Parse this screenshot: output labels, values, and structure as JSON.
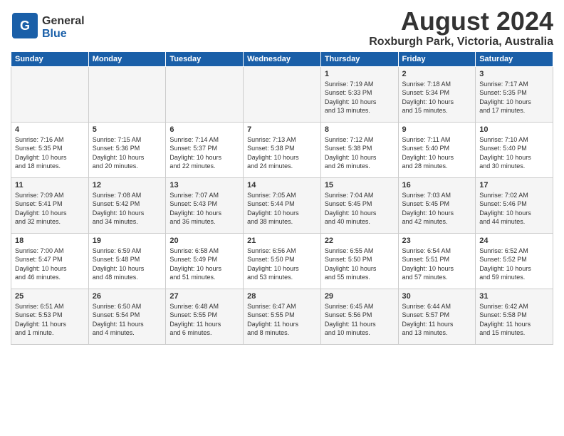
{
  "header": {
    "logo_general": "General",
    "logo_blue": "Blue",
    "month_title": "August 2024",
    "location": "Roxburgh Park, Victoria, Australia"
  },
  "days_of_week": [
    "Sunday",
    "Monday",
    "Tuesday",
    "Wednesday",
    "Thursday",
    "Friday",
    "Saturday"
  ],
  "weeks": [
    [
      {
        "day": "",
        "info": ""
      },
      {
        "day": "",
        "info": ""
      },
      {
        "day": "",
        "info": ""
      },
      {
        "day": "",
        "info": ""
      },
      {
        "day": "1",
        "info": "Sunrise: 7:19 AM\nSunset: 5:33 PM\nDaylight: 10 hours\nand 13 minutes."
      },
      {
        "day": "2",
        "info": "Sunrise: 7:18 AM\nSunset: 5:34 PM\nDaylight: 10 hours\nand 15 minutes."
      },
      {
        "day": "3",
        "info": "Sunrise: 7:17 AM\nSunset: 5:35 PM\nDaylight: 10 hours\nand 17 minutes."
      }
    ],
    [
      {
        "day": "4",
        "info": "Sunrise: 7:16 AM\nSunset: 5:35 PM\nDaylight: 10 hours\nand 18 minutes."
      },
      {
        "day": "5",
        "info": "Sunrise: 7:15 AM\nSunset: 5:36 PM\nDaylight: 10 hours\nand 20 minutes."
      },
      {
        "day": "6",
        "info": "Sunrise: 7:14 AM\nSunset: 5:37 PM\nDaylight: 10 hours\nand 22 minutes."
      },
      {
        "day": "7",
        "info": "Sunrise: 7:13 AM\nSunset: 5:38 PM\nDaylight: 10 hours\nand 24 minutes."
      },
      {
        "day": "8",
        "info": "Sunrise: 7:12 AM\nSunset: 5:38 PM\nDaylight: 10 hours\nand 26 minutes."
      },
      {
        "day": "9",
        "info": "Sunrise: 7:11 AM\nSunset: 5:40 PM\nDaylight: 10 hours\nand 28 minutes."
      },
      {
        "day": "10",
        "info": "Sunrise: 7:10 AM\nSunset: 5:40 PM\nDaylight: 10 hours\nand 30 minutes."
      }
    ],
    [
      {
        "day": "11",
        "info": "Sunrise: 7:09 AM\nSunset: 5:41 PM\nDaylight: 10 hours\nand 32 minutes."
      },
      {
        "day": "12",
        "info": "Sunrise: 7:08 AM\nSunset: 5:42 PM\nDaylight: 10 hours\nand 34 minutes."
      },
      {
        "day": "13",
        "info": "Sunrise: 7:07 AM\nSunset: 5:43 PM\nDaylight: 10 hours\nand 36 minutes."
      },
      {
        "day": "14",
        "info": "Sunrise: 7:05 AM\nSunset: 5:44 PM\nDaylight: 10 hours\nand 38 minutes."
      },
      {
        "day": "15",
        "info": "Sunrise: 7:04 AM\nSunset: 5:45 PM\nDaylight: 10 hours\nand 40 minutes."
      },
      {
        "day": "16",
        "info": "Sunrise: 7:03 AM\nSunset: 5:45 PM\nDaylight: 10 hours\nand 42 minutes."
      },
      {
        "day": "17",
        "info": "Sunrise: 7:02 AM\nSunset: 5:46 PM\nDaylight: 10 hours\nand 44 minutes."
      }
    ],
    [
      {
        "day": "18",
        "info": "Sunrise: 7:00 AM\nSunset: 5:47 PM\nDaylight: 10 hours\nand 46 minutes."
      },
      {
        "day": "19",
        "info": "Sunrise: 6:59 AM\nSunset: 5:48 PM\nDaylight: 10 hours\nand 48 minutes."
      },
      {
        "day": "20",
        "info": "Sunrise: 6:58 AM\nSunset: 5:49 PM\nDaylight: 10 hours\nand 51 minutes."
      },
      {
        "day": "21",
        "info": "Sunrise: 6:56 AM\nSunset: 5:50 PM\nDaylight: 10 hours\nand 53 minutes."
      },
      {
        "day": "22",
        "info": "Sunrise: 6:55 AM\nSunset: 5:50 PM\nDaylight: 10 hours\nand 55 minutes."
      },
      {
        "day": "23",
        "info": "Sunrise: 6:54 AM\nSunset: 5:51 PM\nDaylight: 10 hours\nand 57 minutes."
      },
      {
        "day": "24",
        "info": "Sunrise: 6:52 AM\nSunset: 5:52 PM\nDaylight: 10 hours\nand 59 minutes."
      }
    ],
    [
      {
        "day": "25",
        "info": "Sunrise: 6:51 AM\nSunset: 5:53 PM\nDaylight: 11 hours\nand 1 minute."
      },
      {
        "day": "26",
        "info": "Sunrise: 6:50 AM\nSunset: 5:54 PM\nDaylight: 11 hours\nand 4 minutes."
      },
      {
        "day": "27",
        "info": "Sunrise: 6:48 AM\nSunset: 5:55 PM\nDaylight: 11 hours\nand 6 minutes."
      },
      {
        "day": "28",
        "info": "Sunrise: 6:47 AM\nSunset: 5:55 PM\nDaylight: 11 hours\nand 8 minutes."
      },
      {
        "day": "29",
        "info": "Sunrise: 6:45 AM\nSunset: 5:56 PM\nDaylight: 11 hours\nand 10 minutes."
      },
      {
        "day": "30",
        "info": "Sunrise: 6:44 AM\nSunset: 5:57 PM\nDaylight: 11 hours\nand 13 minutes."
      },
      {
        "day": "31",
        "info": "Sunrise: 6:42 AM\nSunset: 5:58 PM\nDaylight: 11 hours\nand 15 minutes."
      }
    ]
  ]
}
